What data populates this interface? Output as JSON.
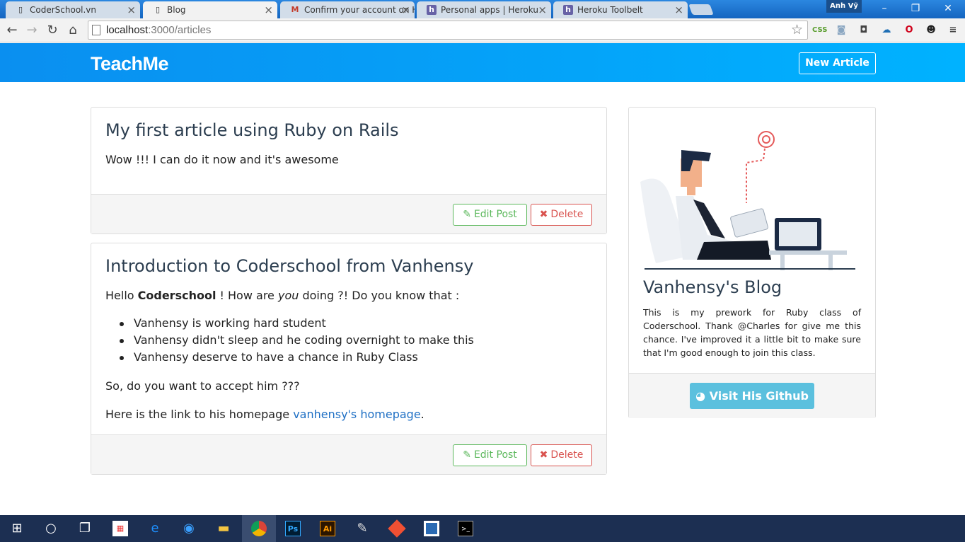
{
  "browser": {
    "tabs": [
      {
        "title": "CoderSchool.vn",
        "icon": "page-icon"
      },
      {
        "title": "Blog",
        "icon": "page-icon"
      },
      {
        "title": "Confirm your account on H",
        "icon": "gmail-icon"
      },
      {
        "title": "Personal apps | Heroku",
        "icon": "heroku-icon"
      },
      {
        "title": "Heroku Toolbelt",
        "icon": "heroku-icon"
      }
    ],
    "profile_name": "Anh Vỹ",
    "url_host": "localhost",
    "url_path": ":3000/articles",
    "extensions": [
      "css-icon",
      "camera-icon",
      "pocket-icon",
      "cloud-icon",
      "opera-icon",
      "panda-icon"
    ]
  },
  "site": {
    "brand": "TeachMe",
    "new_article_label": "New Article",
    "accent": "#0a8ff0"
  },
  "articles": [
    {
      "title": "My first article using Ruby on Rails",
      "body": "Wow !!! I can do it now and it's awesome",
      "edit_label": "Edit Post",
      "delete_label": "Delete"
    },
    {
      "title": "Introduction to Coderschool from Vanhensy",
      "intro_hello": "Hello ",
      "intro_bold": "Coderschool",
      "intro_mid": " ! How are ",
      "intro_em": "you",
      "intro_end": " doing ?! Do you know that :",
      "bullets": [
        "Vanhensy is working hard student",
        "Vanhensy didn't sleep and he coding overnight to make this",
        "Vanhensy deserve to have a chance in Ruby Class"
      ],
      "question": "So, do you want to accept him ???",
      "link_prefix": "Here is the link to his homepage ",
      "link_text": "vanhensy's homepage",
      "link_suffix": ".",
      "edit_label": "Edit Post",
      "delete_label": "Delete"
    }
  ],
  "sidebar": {
    "title": "Vanhensy's Blog",
    "description": "This is my prework for Ruby class of Coderschool. Thank @Charles for give me this chance. I've improved it a little bit to make sure that I'm good enough to join this class.",
    "github_label": "Visit His Github"
  },
  "taskbar": {
    "items": [
      "windows-start-icon",
      "cortana-icon",
      "task-view-icon",
      "store-icon",
      "edge-icon",
      "firefox-icon",
      "file-explorer-icon",
      "chrome-icon",
      "photoshop-icon",
      "illustrator-icon",
      "paint-icon",
      "git-icon",
      "sourcetree-icon",
      "terminal-icon"
    ],
    "ps_label": "Ps",
    "ai_label": "Ai"
  }
}
